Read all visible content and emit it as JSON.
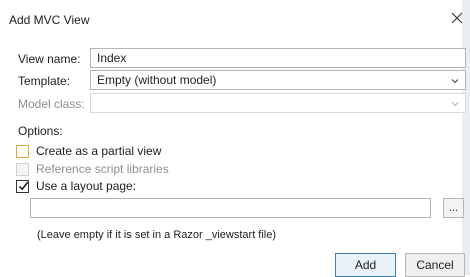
{
  "window": {
    "title": "Add MVC View",
    "close_icon": "close-icon"
  },
  "form": {
    "view_name_label": "View name:",
    "view_name_value": "Index",
    "template_label": "Template:",
    "template_value": "Empty (without model)",
    "model_class_label": "Model class:",
    "model_class_value": ""
  },
  "options": {
    "heading": "Options:",
    "partial_view": {
      "label": "Create as a partial view",
      "checked": false
    },
    "reference_scripts": {
      "label": "Reference script libraries",
      "checked": false,
      "disabled": true
    },
    "use_layout": {
      "label": "Use a layout page:",
      "checked": true
    }
  },
  "layout": {
    "path_value": "",
    "browse_label": "...",
    "hint": "(Leave empty if it is set in a Razor _viewstart file)"
  },
  "buttons": {
    "add": "Add",
    "cancel": "Cancel"
  }
}
